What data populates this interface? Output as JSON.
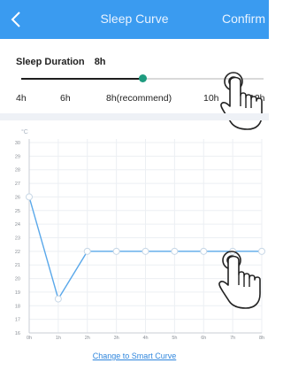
{
  "header": {
    "title": "Sleep Curve",
    "confirm_label": "Confirm",
    "back_icon": "chevron-left-icon"
  },
  "duration": {
    "label": "Sleep Duration",
    "value": "8h",
    "slider_fraction": 0.5
  },
  "duration_options": [
    "4h",
    "6h",
    "8h(recommend)",
    "10h",
    "12h"
  ],
  "chart_data": {
    "type": "line",
    "y_unit": "°C",
    "ylim": [
      16,
      30
    ],
    "y_ticks": [
      30,
      29,
      28,
      27,
      26,
      25,
      24,
      23,
      22,
      21,
      20,
      19,
      18,
      17,
      16
    ],
    "x_ticks": [
      "0h",
      "1h",
      "2h",
      "3h",
      "4h",
      "5h",
      "6h",
      "7h",
      "8h"
    ],
    "x": [
      0,
      1,
      2,
      3,
      4,
      5,
      6,
      7,
      8
    ],
    "series": [
      {
        "values": [
          26,
          18.5,
          22,
          22,
          22,
          22,
          22,
          22,
          22
        ]
      }
    ],
    "grid": true,
    "line_color": "#5aa8ea"
  },
  "footer": {
    "smart_curve_label": "Change to Smart Curve"
  }
}
